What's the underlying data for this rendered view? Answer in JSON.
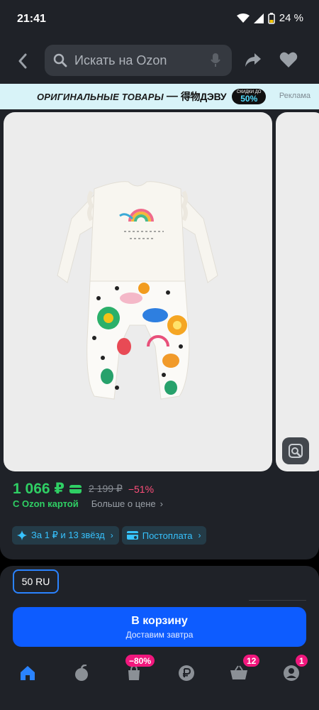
{
  "status": {
    "time": "21:41",
    "battery": "24 %"
  },
  "header": {
    "search_placeholder": "Искать на Ozon"
  },
  "ad_banner": {
    "text": "ОРИГИНАЛЬНЫЕ ТОВАРЫ",
    "dash": "—",
    "brand": "得物ДЭВУ",
    "sale_top": "СКИДКИ ДО",
    "sale_value": "50%",
    "label": "Реклама"
  },
  "product": {
    "price": "1 066 ₽",
    "old_price": "2 199 ₽",
    "discount": "−51%",
    "ozon_card": "С Ozon картой",
    "more_price": "Больше о цене",
    "chips": [
      {
        "label": "За 1 ₽ и 13 звёзд"
      },
      {
        "label": "Постоплата"
      }
    ]
  },
  "purchase": {
    "size": "50 RU",
    "cart_title": "В корзину",
    "cart_subtitle": "Доставим завтра"
  },
  "nav": {
    "badges": {
      "promo": "−80%",
      "cart": "12",
      "profile": "1"
    }
  },
  "colors": {
    "accent": "#0d5cff",
    "price": "#2fcf64",
    "discount": "#ff4f7a",
    "badge": "#f1177d",
    "chip_text": "#37c3ff"
  }
}
